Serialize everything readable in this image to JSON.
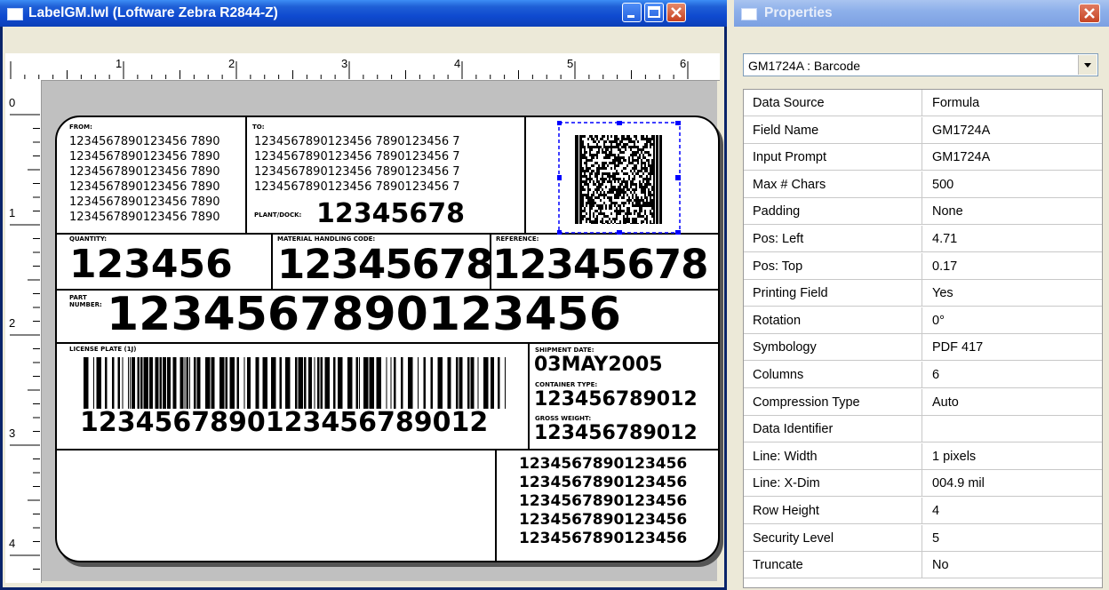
{
  "label_window": {
    "title": "LabelGM.lwl (Loftware Zebra R2844-Z)",
    "ruler_h_numbers": [
      "1",
      "2",
      "3",
      "4",
      "5",
      "6"
    ],
    "ruler_v_numbers": [
      "0",
      "1",
      "2",
      "3",
      "4"
    ]
  },
  "label": {
    "from_label": "FROM:",
    "from_lines": [
      "1234567890123456 7890",
      "1234567890123456 7890",
      "1234567890123456 7890",
      "1234567890123456 7890",
      "1234567890123456 7890",
      "1234567890123456 7890"
    ],
    "to_label": "TO:",
    "to_lines": [
      "1234567890123456 7890123456 7",
      "1234567890123456 7890123456 7",
      "1234567890123456 7890123456 7",
      "1234567890123456 7890123456 7"
    ],
    "plant_dock_label": "PLANT/DOCK:",
    "plant_dock_value": "12345678",
    "quantity_label": "QUANTITY:",
    "quantity_value": "123456",
    "material_label": "MATERIAL HANDLING CODE:",
    "material_value": "12345678",
    "reference_label": "REFERENCE:",
    "reference_value": "12345678",
    "part_label_1": "PART",
    "part_label_2": "NUMBER:",
    "part_value": "1234567890123456",
    "license_label": "LICENSE PLATE (1J)",
    "license_value": "1234567890123456789012",
    "ship_date_label": "SHIPMENT DATE:",
    "ship_date_value": "03MAY2005",
    "container_label": "CONTAINER TYPE:",
    "container_value": "123456789012",
    "gross_label": "GROSS WEIGHT:",
    "gross_value": "123456789012",
    "bottom_lines": [
      "1234567890123456",
      "1234567890123456",
      "1234567890123456",
      "1234567890123456",
      "1234567890123456"
    ]
  },
  "properties": {
    "title": "Properties",
    "selected_object": "GM1724A : Barcode",
    "rows": [
      {
        "name": "Data Source",
        "value": "Formula"
      },
      {
        "name": "Field Name",
        "value": "GM1724A"
      },
      {
        "name": "Input Prompt",
        "value": "GM1724A"
      },
      {
        "name": "Max # Chars",
        "value": "500"
      },
      {
        "name": "Padding",
        "value": "None"
      },
      {
        "name": "Pos: Left",
        "value": "4.71"
      },
      {
        "name": "Pos: Top",
        "value": "0.17"
      },
      {
        "name": "Printing Field",
        "value": "Yes"
      },
      {
        "name": "Rotation",
        "value": "0°"
      },
      {
        "name": "Symbology",
        "value": "PDF 417"
      },
      {
        "name": "Columns",
        "value": "6"
      },
      {
        "name": "Compression Type",
        "value": "Auto"
      },
      {
        "name": "Data Identifier",
        "value": ""
      },
      {
        "name": "Line:  Width",
        "value": " 1 pixels"
      },
      {
        "name": "Line: X-Dim",
        "value": "004.9 mil"
      },
      {
        "name": "Row Height",
        "value": "4"
      },
      {
        "name": "Security Level",
        "value": "5"
      },
      {
        "name": "Truncate",
        "value": "No"
      }
    ]
  }
}
